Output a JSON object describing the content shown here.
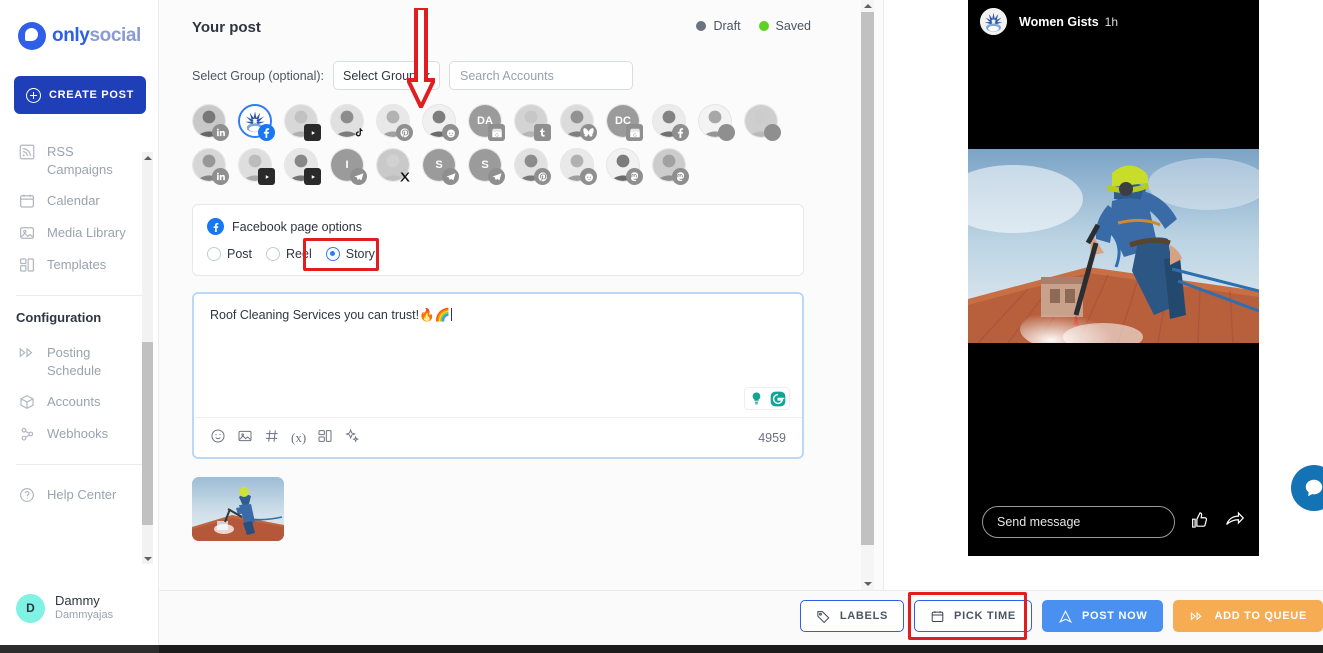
{
  "sidebar": {
    "brand": {
      "only": "only",
      "social": "social"
    },
    "create_post_label": "CREATE POST",
    "items": [
      {
        "label": "RSS Campaigns",
        "icon": "rss-icon"
      },
      {
        "label": "Calendar",
        "icon": "calendar-icon"
      },
      {
        "label": "Media Library",
        "icon": "media-library-icon"
      },
      {
        "label": "Templates",
        "icon": "templates-icon"
      }
    ],
    "section_title": "Configuration",
    "config_items": [
      {
        "label": "Posting Schedule",
        "icon": "posting-schedule-icon"
      },
      {
        "label": "Accounts",
        "icon": "accounts-icon"
      },
      {
        "label": "Webhooks",
        "icon": "webhooks-icon"
      }
    ],
    "help_item": {
      "label": "Help Center",
      "icon": "help-icon"
    },
    "user": {
      "initial": "D",
      "name": "Dammy",
      "handle": "Dammyajas"
    }
  },
  "main": {
    "title": "Your post",
    "status": [
      {
        "label": "Draft",
        "color": "#6b7280"
      },
      {
        "label": "Saved",
        "color": "#5fd11e"
      }
    ],
    "group_row": {
      "label": "Select Group (optional):",
      "select_value": "Select Group",
      "search_placeholder": "Search Accounts",
      "search_value": ""
    },
    "accounts": [
      {
        "name": "linkedin-account-1",
        "platform": "linkedin",
        "selected": false,
        "initials": ""
      },
      {
        "name": "facebook-account-womengists",
        "platform": "facebook",
        "selected": true,
        "initials": ""
      },
      {
        "name": "youtube-account-1",
        "platform": "youtube",
        "selected": false,
        "initials": ""
      },
      {
        "name": "tiktok-account-1",
        "platform": "tiktok",
        "selected": false,
        "initials": ""
      },
      {
        "name": "pinterest-account-1",
        "platform": "pinterest",
        "selected": false,
        "initials": ""
      },
      {
        "name": "reddit-account-1",
        "platform": "reddit",
        "selected": false,
        "initials": ""
      },
      {
        "name": "google-business-account-da",
        "platform": "google-business",
        "selected": false,
        "initials": "DA"
      },
      {
        "name": "tumblr-account-1",
        "platform": "tumblr",
        "selected": false,
        "initials": ""
      },
      {
        "name": "bluesky-account-1",
        "platform": "bluesky",
        "selected": false,
        "initials": ""
      },
      {
        "name": "google-business-account-dc",
        "platform": "google-business",
        "selected": false,
        "initials": "DC"
      },
      {
        "name": "facebook-account-2",
        "platform": "facebook-grey",
        "selected": false,
        "initials": ""
      },
      {
        "name": "instagram-account-1",
        "platform": "instagram",
        "selected": false,
        "initials": ""
      },
      {
        "name": "instagram-account-2",
        "platform": "instagram",
        "selected": false,
        "initials": ""
      },
      {
        "name": "linkedin-account-2",
        "platform": "linkedin",
        "selected": false,
        "initials": ""
      },
      {
        "name": "youtube-account-2",
        "platform": "youtube",
        "selected": false,
        "initials": ""
      },
      {
        "name": "youtube-account-3",
        "platform": "youtube",
        "selected": false,
        "initials": ""
      },
      {
        "name": "telegram-account-1",
        "platform": "telegram",
        "selected": false,
        "initials": "I"
      },
      {
        "name": "x-account-1",
        "platform": "x",
        "selected": false,
        "initials": ""
      },
      {
        "name": "telegram-account-2",
        "platform": "telegram",
        "selected": false,
        "initials": "S"
      },
      {
        "name": "telegram-account-3",
        "platform": "telegram",
        "selected": false,
        "initials": "S"
      },
      {
        "name": "pinterest-account-2",
        "platform": "pinterest",
        "selected": false,
        "initials": ""
      },
      {
        "name": "reddit-account-2",
        "platform": "reddit",
        "selected": false,
        "initials": ""
      },
      {
        "name": "mastodon-account-1",
        "platform": "mastodon",
        "selected": false,
        "initials": ""
      },
      {
        "name": "mastodon-account-2",
        "platform": "mastodon",
        "selected": false,
        "initials": ""
      }
    ],
    "facebook_options": {
      "heading": "Facebook page options",
      "choices": [
        {
          "label": "Post",
          "selected": false
        },
        {
          "label": "Reel",
          "selected": false
        },
        {
          "label": "Story",
          "selected": true
        }
      ],
      "highlighted_choice": "Story"
    },
    "editor": {
      "text": "Roof Cleaning Services you can trust!🔥🌈",
      "char_count": "4959",
      "tool_icons": [
        "emoji-icon",
        "image-icon",
        "hashtag-icon",
        "variable-icon",
        "template-icon",
        "ai-sparkle-icon"
      ],
      "assist_icons": [
        "grammarly-idea-icon",
        "grammarly-icon"
      ]
    },
    "attachment_name": "roof-cleaning-thumbnail"
  },
  "preview": {
    "account_name": "Women Gists",
    "timestamp": "1h",
    "send_message_placeholder": "Send message",
    "actions": [
      "like-icon",
      "share-icon"
    ]
  },
  "bottom_bar": {
    "buttons": [
      {
        "label": "LABELS",
        "icon": "tag-icon",
        "style": "outline",
        "highlighted": false
      },
      {
        "label": "PICK TIME",
        "icon": "calendar-icon",
        "style": "outline",
        "highlighted": true
      },
      {
        "label": "POST NOW",
        "icon": "send-icon",
        "style": "blue",
        "highlighted": false
      },
      {
        "label": "ADD TO QUEUE",
        "icon": "queue-icon",
        "style": "orange",
        "highlighted": false
      }
    ]
  },
  "annotations": {
    "arrow_target": "facebook-account-womengists",
    "arrow_color": "#e11d20",
    "highlight_color": "#e11d20"
  },
  "colors": {
    "brand_blue": "#2f5fe8",
    "facebook_blue": "#1877f2",
    "saved_green": "#5fd11e",
    "draft_grey": "#6b7280",
    "queue_orange": "#f5ac53",
    "post_now_blue": "#4a90f0"
  }
}
